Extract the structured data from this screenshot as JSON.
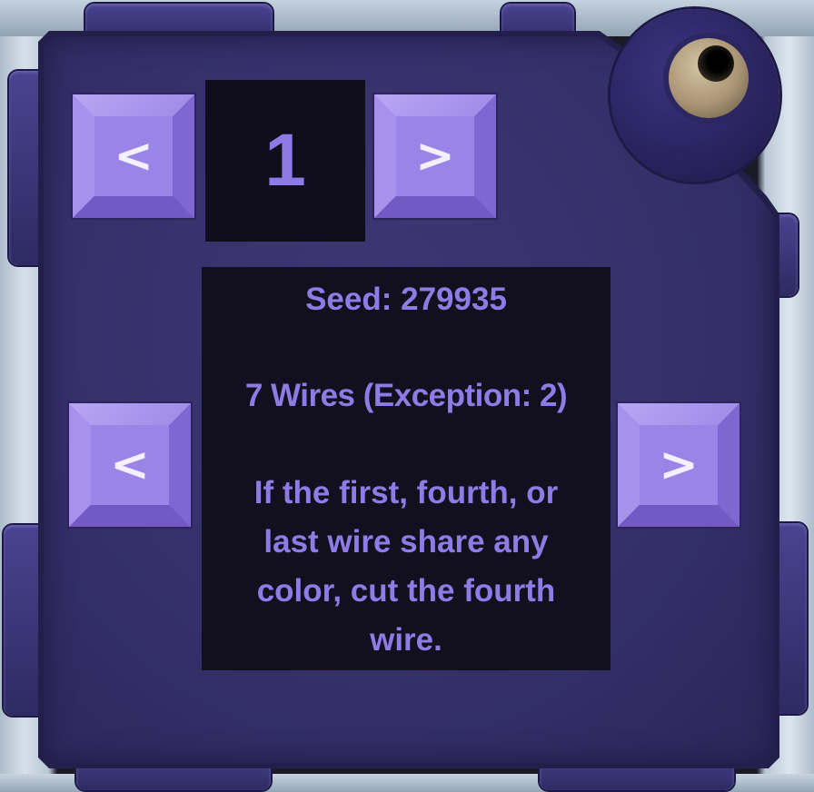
{
  "module": {
    "page_number": "1",
    "page_prev_label": "<",
    "page_next_label": ">",
    "rule_prev_label": "<",
    "rule_next_label": ">",
    "seed_text": "Seed: 279935",
    "wires_text": "7 Wires (Exception: 2)",
    "rule_text": "If the first, fourth, or last wire share any color, cut the fourth wire."
  },
  "colors": {
    "panel": "#35306a",
    "button": "#9a83e6",
    "display_bg": "#120f1f",
    "display_text": "#8f7be6"
  }
}
